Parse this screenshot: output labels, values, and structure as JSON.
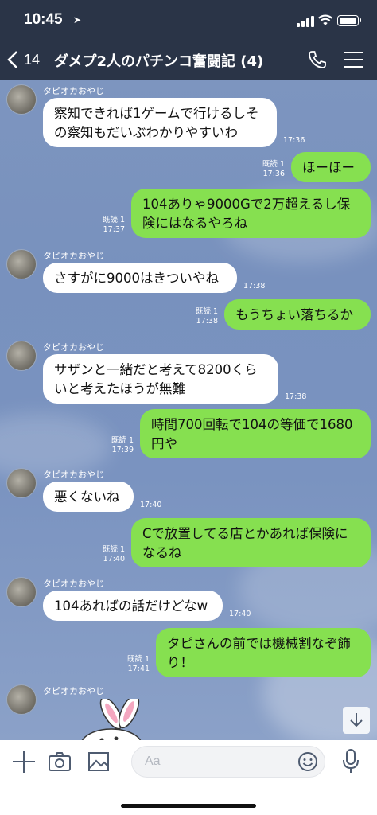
{
  "status_bar": {
    "time": "10:45",
    "location_arrow": "➤"
  },
  "header": {
    "back_count": "14",
    "title": "ダメプ2人のパチンコ奮闘記 (4)"
  },
  "icons": {
    "back": "chevron-left-icon",
    "call": "phone-icon",
    "menu": "hamburger-icon",
    "add": "plus-icon",
    "camera": "camera-icon",
    "image": "image-icon",
    "emoji": "smile-icon",
    "mic": "microphone-icon",
    "scroll": "arrow-down-icon"
  },
  "colors": {
    "header_bg": "#2a3447",
    "outgoing_bubble": "#86e050",
    "incoming_bubble": "#ffffff"
  },
  "messages": [
    {
      "dir": "in",
      "sender": "タピオカおやじ",
      "lines": [
        "察知できれば1ゲームで行けるしそ",
        "の察知もだいぶわかりやすいわ"
      ],
      "time": "17:36"
    },
    {
      "dir": "out",
      "read": "既読 1",
      "lines": [
        "ほーほー"
      ],
      "time": "17:36"
    },
    {
      "dir": "out",
      "read": "既読 1",
      "lines": [
        "104ありゃ9000Gで2万超えるし保",
        "険にはなるやろね"
      ],
      "time": "17:37"
    },
    {
      "dir": "in",
      "sender": "タピオカおやじ",
      "lines": [
        "さすがに9000はきついやね"
      ],
      "time": "17:38"
    },
    {
      "dir": "out",
      "read": "既読 1",
      "lines": [
        "もうちょい落ちるか"
      ],
      "time": "17:38"
    },
    {
      "dir": "in",
      "sender": "タピオカおやじ",
      "lines": [
        "サザンと一緒だと考えて8200くら",
        "いと考えたほうが無難"
      ],
      "time": "17:38"
    },
    {
      "dir": "out",
      "read": "既読 1",
      "lines": [
        "時間700回転で104の等価で1680",
        "円や"
      ],
      "time": "17:39"
    },
    {
      "dir": "in",
      "sender": "タピオカおやじ",
      "lines": [
        "悪くないね"
      ],
      "time": "17:40"
    },
    {
      "dir": "out",
      "read": "既読 1",
      "lines": [
        "Cで放置してる店とかあれば保険に",
        "なるね"
      ],
      "time": "17:40"
    },
    {
      "dir": "in",
      "sender": "タピオカおやじ",
      "lines": [
        "104あればの話だけどなw"
      ],
      "time": "17:40"
    },
    {
      "dir": "out",
      "read": "既読 1",
      "lines": [
        "タピさんの前では機械割なぞ飾",
        "り！"
      ],
      "time": "17:41"
    },
    {
      "dir": "in",
      "sender": "タピオカおやじ",
      "sticker": "rabbit-sticker"
    }
  ],
  "input": {
    "placeholder": "Aa"
  }
}
